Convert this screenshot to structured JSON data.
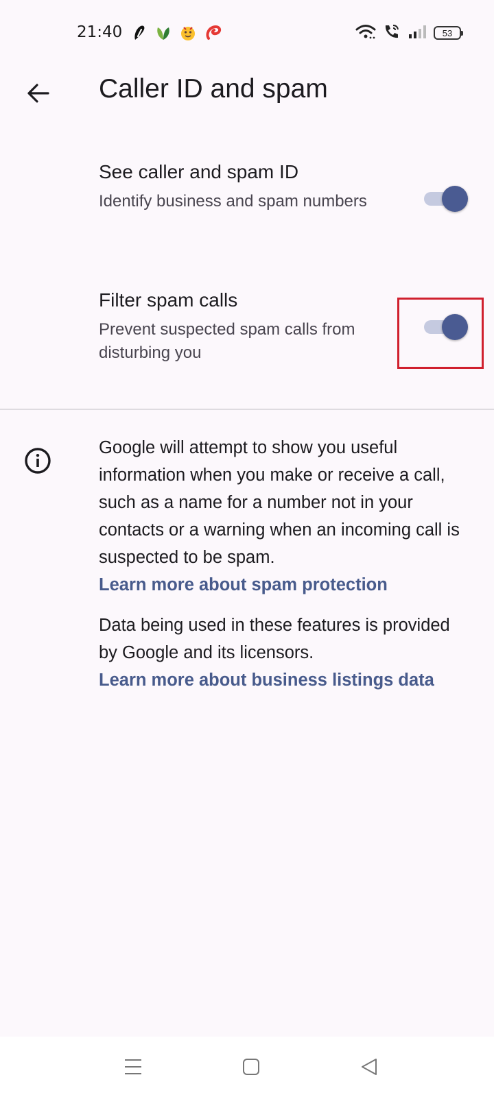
{
  "status_bar": {
    "time": "21:40",
    "battery_level": "53",
    "notification_icons": [
      "app-icon-one",
      "leaf-icon",
      "emoji-icon",
      "airtel-icon"
    ],
    "system_icons": [
      "wifi-icon",
      "wifi-calling-icon",
      "signal-icon",
      "battery-icon"
    ]
  },
  "app_bar": {
    "back_icon": "arrow-back-icon",
    "title": "Caller ID and spam"
  },
  "settings": [
    {
      "title": "See caller and spam ID",
      "summary": "Identify business and spam numbers",
      "enabled": true
    },
    {
      "title": "Filter spam calls",
      "summary": "Prevent suspected spam calls from disturbing you",
      "enabled": true
    }
  ],
  "info": {
    "icon": "info-icon",
    "paragraph_1": "Google will attempt to show you useful information when you make or receive a call, such as a name for a number not in your contacts or a warning when an incoming call is suspected to be spam.",
    "link_1": "Learn more about spam protection",
    "paragraph_2": "Data being used in these features is provided by Google and its licensors.",
    "link_2": "Learn more about business listings data"
  },
  "nav_bar": {
    "items": [
      "menu-icon",
      "home-icon",
      "back-triangle-icon"
    ]
  },
  "colors": {
    "background": "#fcf8fc",
    "accent": "#4a5b92",
    "switch_track": "#c5cae0",
    "link": "#485b8c",
    "highlight": "#d0202e"
  }
}
